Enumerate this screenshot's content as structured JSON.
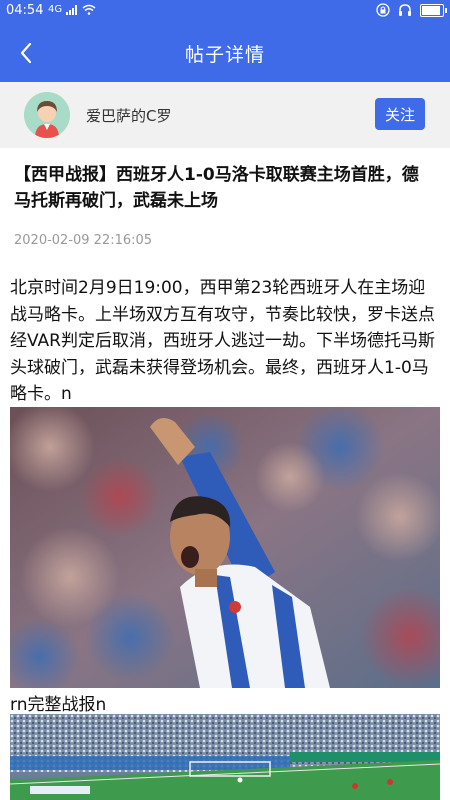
{
  "status_bar": {
    "time": "04:54",
    "network": "4G"
  },
  "header": {
    "title": "帖子详情"
  },
  "author": {
    "name": "爱巴萨的C罗",
    "follow_label": "关注"
  },
  "post": {
    "title": "【西甲战报】西班牙人1-0马洛卡取联赛主场首胜，德马托斯再破门，武磊未上场",
    "time": "2020-02-09 22:16:05",
    "body": "北京时间2月9日19:00，西甲第23轮西班牙人在主场迎战马略卡。上半场双方互有攻守，节奏比较快，罗卡送点经VAR判定后取消，西班牙人逃过一劫。下半场德托马斯头球破门，武磊未获得登场机会。最终，西班牙人1-0马略卡。n",
    "caption": "rn完整战报n"
  },
  "colors": {
    "primary": "#3f6be8",
    "author_bar_bg": "#f1f1f1",
    "time_text": "#999999"
  }
}
